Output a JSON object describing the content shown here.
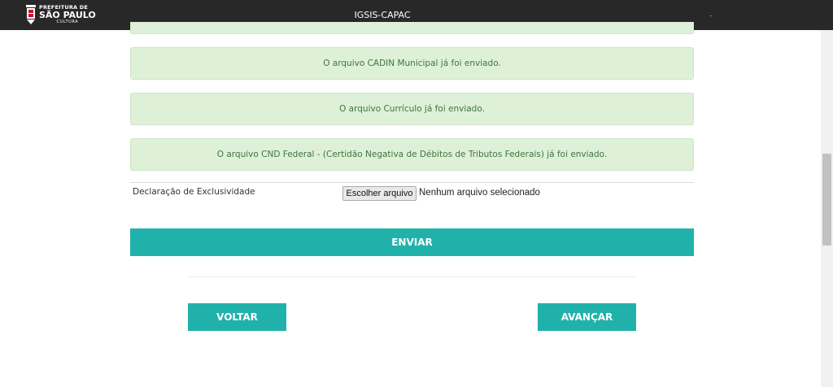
{
  "header": {
    "logo": {
      "line1": "PREFEITURA DE",
      "line2": "SÃO PAULO",
      "line3": "CULTURA"
    },
    "app_title": "IGSIS-CAPAC",
    "background": "#282828"
  },
  "alerts": [
    "O arquivo CADIN Municipal já foi enviado.",
    "O arquivo Currículo já foi enviado.",
    "O arquivo CND Federal - (Certidão Negativa de Débitos de Tributos Federais) já foi enviado."
  ],
  "upload": {
    "label": "Declaração de Exclusividade",
    "button_label": "Escolher arquivo",
    "status": "Nenhum arquivo selecionado"
  },
  "actions": {
    "send_label": "ENVIAR",
    "back_label": "VOLTAR",
    "next_label": "AVANÇAR"
  },
  "colors": {
    "accent": "#20b2aa",
    "alert_bg": "#dff0d8",
    "alert_text": "#3c763d"
  }
}
